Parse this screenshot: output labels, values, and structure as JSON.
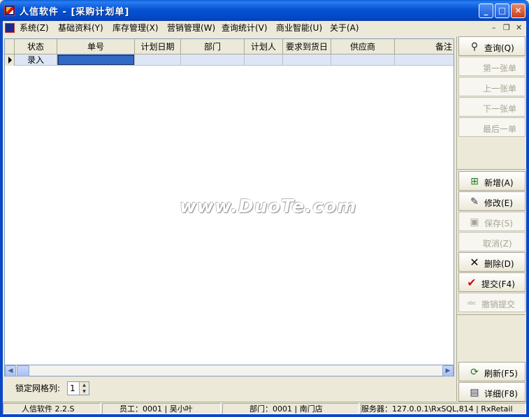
{
  "window": {
    "title": "人信软件 - [采购计划单]",
    "minimize": "_",
    "maximize": "□",
    "close": "✕"
  },
  "menu": {
    "items": [
      "系统(Z)",
      "基础资料(Y)",
      "库存管理(X)",
      "营销管理(W)",
      "查询统计(V)",
      "商业智能(U)",
      "关于(A)"
    ],
    "mdi_min": "–",
    "mdi_restore": "❐",
    "mdi_close": "✕"
  },
  "grid": {
    "columns": [
      "状态",
      "单号",
      "计划日期",
      "部门",
      "计划人",
      "要求到货日",
      "供应商",
      "备注"
    ],
    "rows": [
      {
        "status": "录入",
        "number": "",
        "date": "",
        "dept": "",
        "planner": "",
        "arrival": "",
        "supplier": "",
        "note": ""
      }
    ]
  },
  "watermark": "www.DuoTe.com",
  "lock": {
    "label": "锁定网格列:",
    "value": "1"
  },
  "toolbar": {
    "query": "查询(Q)",
    "first": "第一张单",
    "prev": "上一张单",
    "next": "下一张单",
    "last": "最后一单",
    "add": "新增(A)",
    "edit": "修改(E)",
    "save": "保存(S)",
    "cancel": "取消(Z)",
    "delete": "删除(D)",
    "submit": "提交(F4)",
    "unsubmit": "撤销提交",
    "refresh": "刷新(F5)",
    "detail": "详细(F8)"
  },
  "status": {
    "app": "人信软件 2.2.S",
    "employee": "员工：0001 | 吴小叶",
    "department": "部门：0001 | 南门店",
    "server": "服务器：127.0.0.1\\RxSQL,814 | RxRetail"
  }
}
